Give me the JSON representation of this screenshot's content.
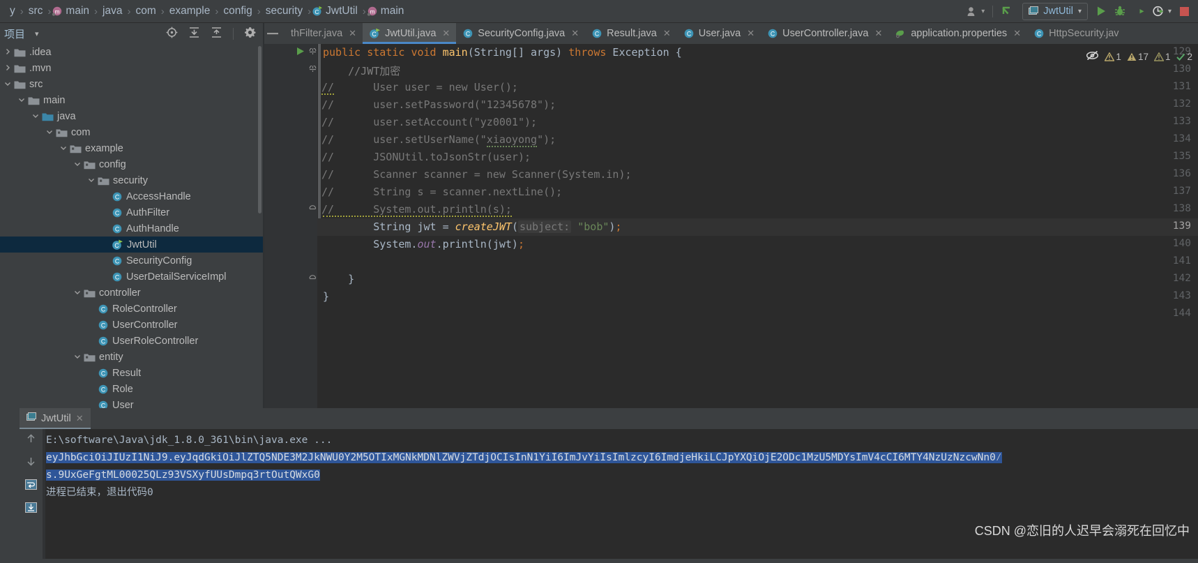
{
  "breadcrumb": {
    "items": [
      "y",
      "src",
      "main",
      "java",
      "com",
      "example",
      "config",
      "security",
      "JwtUtil",
      "main"
    ],
    "separator": "›",
    "class_icon": "class-icon",
    "method_icon": "method-icon"
  },
  "toolbar": {
    "account_icon": "account-icon",
    "account_caret": "▾",
    "update_icon": "update-arrow-icon",
    "run_config_icon": "run-config-icon",
    "run_config_label": "JwtUtil",
    "run_config_caret": "▾",
    "run_icon": "run-icon",
    "debug_icon": "debug-icon",
    "coverage_icon": "run-with-coverage-icon",
    "profile_icon": "profiler-icon",
    "profile_caret": "▾",
    "stop_icon": "stop-icon"
  },
  "project_panel": {
    "title": "项目",
    "caret": "▾",
    "tools": [
      {
        "name": "locate-icon",
        "glyph": "⊕"
      },
      {
        "name": "expand-all-icon",
        "glyph": "⤓"
      },
      {
        "name": "collapse-all-icon",
        "glyph": "⤒"
      },
      {
        "name": "settings-gear-icon",
        "glyph": "⚙"
      }
    ],
    "tree": [
      {
        "label": ".idea",
        "depth": 0,
        "arrow": "›",
        "icon": "folder-icon",
        "selected": false
      },
      {
        "label": ".mvn",
        "depth": 0,
        "arrow": "›",
        "icon": "folder-icon",
        "selected": false
      },
      {
        "label": "src",
        "depth": 0,
        "arrow": "⌄",
        "icon": "folder-icon",
        "selected": false
      },
      {
        "label": "main",
        "depth": 1,
        "arrow": "⌄",
        "icon": "folder-icon",
        "selected": false
      },
      {
        "label": "java",
        "depth": 2,
        "arrow": "⌄",
        "icon": "source-folder-icon",
        "selected": false
      },
      {
        "label": "com",
        "depth": 3,
        "arrow": "⌄",
        "icon": "package-icon",
        "selected": false
      },
      {
        "label": "example",
        "depth": 4,
        "arrow": "⌄",
        "icon": "package-icon",
        "selected": false
      },
      {
        "label": "config",
        "depth": 5,
        "arrow": "⌄",
        "icon": "package-icon",
        "selected": false
      },
      {
        "label": "security",
        "depth": 6,
        "arrow": "⌄",
        "icon": "package-icon",
        "selected": false
      },
      {
        "label": "AccessHandle",
        "depth": 7,
        "arrow": "",
        "icon": "class-icon",
        "selected": false
      },
      {
        "label": "AuthFilter",
        "depth": 7,
        "arrow": "",
        "icon": "class-icon",
        "selected": false
      },
      {
        "label": "AuthHandle",
        "depth": 7,
        "arrow": "",
        "icon": "class-icon",
        "selected": false
      },
      {
        "label": "JwtUtil",
        "depth": 7,
        "arrow": "",
        "icon": "runnable-class-icon",
        "selected": true
      },
      {
        "label": "SecurityConfig",
        "depth": 7,
        "arrow": "",
        "icon": "class-icon",
        "selected": false
      },
      {
        "label": "UserDetailServiceImpl",
        "depth": 7,
        "arrow": "",
        "icon": "class-icon",
        "selected": false
      },
      {
        "label": "controller",
        "depth": 5,
        "arrow": "⌄",
        "icon": "package-icon",
        "selected": false
      },
      {
        "label": "RoleController",
        "depth": 6,
        "arrow": "",
        "icon": "class-icon",
        "selected": false
      },
      {
        "label": "UserController",
        "depth": 6,
        "arrow": "",
        "icon": "class-icon",
        "selected": false
      },
      {
        "label": "UserRoleController",
        "depth": 6,
        "arrow": "",
        "icon": "class-icon",
        "selected": false
      },
      {
        "label": "entity",
        "depth": 5,
        "arrow": "⌄",
        "icon": "package-icon",
        "selected": false
      },
      {
        "label": "Result",
        "depth": 6,
        "arrow": "",
        "icon": "class-icon",
        "selected": false
      },
      {
        "label": "Role",
        "depth": 6,
        "arrow": "",
        "icon": "class-icon",
        "selected": false
      },
      {
        "label": "User",
        "depth": 6,
        "arrow": "",
        "icon": "class-icon",
        "selected": false
      }
    ]
  },
  "editor": {
    "hide_tabs_icon": "minimize-tabs-icon",
    "tabs": [
      {
        "label": "thFilter.java",
        "icon": "class-icon",
        "active": false,
        "close": "✕",
        "truncated": true
      },
      {
        "label": "JwtUtil.java",
        "icon": "runnable-class-icon",
        "active": true,
        "close": "✕",
        "truncated": false
      },
      {
        "label": "SecurityConfig.java",
        "icon": "class-icon",
        "active": false,
        "close": "✕",
        "truncated": false
      },
      {
        "label": "Result.java",
        "icon": "class-icon",
        "active": false,
        "close": "✕",
        "truncated": false
      },
      {
        "label": "User.java",
        "icon": "class-icon",
        "active": false,
        "close": "✕",
        "truncated": false
      },
      {
        "label": "UserController.java",
        "icon": "class-icon",
        "active": false,
        "close": "✕",
        "truncated": false
      },
      {
        "label": "application.properties",
        "icon": "properties-icon",
        "active": false,
        "close": "✕",
        "truncated": false
      },
      {
        "label": "HttpSecurity.jav",
        "icon": "class-icon",
        "active": false,
        "close": "",
        "truncated": true
      }
    ],
    "line_numbers": [
      "129",
      "130",
      "131",
      "132",
      "133",
      "134",
      "135",
      "136",
      "137",
      "138",
      "139",
      "140",
      "141",
      "142",
      "143",
      "144"
    ],
    "current_line": "139",
    "run_gutter_icon": "run-method-icon",
    "inspections": {
      "eye_icon": "inspections-off-icon",
      "badges": [
        {
          "icon": "warning-icon",
          "count": "1",
          "color": "#bbb529"
        },
        {
          "icon": "warning-icon",
          "count": "17",
          "color": "#bbb529"
        },
        {
          "icon": "weak-warning-icon",
          "count": "1",
          "color": "#bbb529"
        },
        {
          "icon": "ok-check-icon",
          "count": "2",
          "color": "#59a869"
        }
      ]
    },
    "code_lines": [
      "public static void main(String[] args) throws Exception {",
      "    //JWT加密",
      "//        User user = new User();",
      "//        user.setPassword(\"12345678\");",
      "//        user.setAccount(\"yz0001\");",
      "//        user.setUserName(\"xiaoyong\");",
      "//        JSONUtil.toJsonStr(user);",
      "//        Scanner scanner = new Scanner(System.in);",
      "//        String s = scanner.nextLine();",
      "//        System.out.println(s);",
      "        String jwt = createJWT( subject: \"bob\");",
      "        System.out.println(jwt);",
      "",
      "    }",
      "}",
      ""
    ],
    "hint_label": "subject:",
    "string_literal": "\"bob\""
  },
  "console": {
    "tab_label": "JwtUtil",
    "tab_icon": "run-config-icon",
    "tab_close": "✕",
    "rail_icons": [
      {
        "name": "scroll-up-icon",
        "glyph": "↑"
      },
      {
        "name": "scroll-down-icon",
        "glyph": "↓"
      },
      {
        "name": "soft-wrap-icon",
        "glyph": "↵"
      },
      {
        "name": "print-icon",
        "glyph": "⤓"
      }
    ],
    "lines": [
      {
        "text": "E:\\software\\Java\\jdk_1.8.0_361\\bin\\java.exe ...",
        "highlighted": false
      },
      {
        "text": "eyJhbGciOiJIUzI1NiJ9.eyJqdGkiOiJlZTQ5NDE3M2JkNWU0Y2M5OTIxMGNkMDNlZWVjZTdjOCIsInN1YiI6ImJvYiIsImlzcyI6ImdjeHkiLCJpYXQiOjE2ODc1MzU5MDYsImV4cCI6MTY4NzUzNzcwNn0⁄",
        "highlighted": true
      },
      {
        "text": "s.9UxGeFgtML00025QLz93VSXyfUUsDmpq3rtOutQWxG0",
        "highlighted": true
      },
      {
        "text": "进程已结束，退出代码0",
        "highlighted": false
      }
    ],
    "watermark": "CSDN @恋旧的人迟早会溺死在回忆中"
  }
}
